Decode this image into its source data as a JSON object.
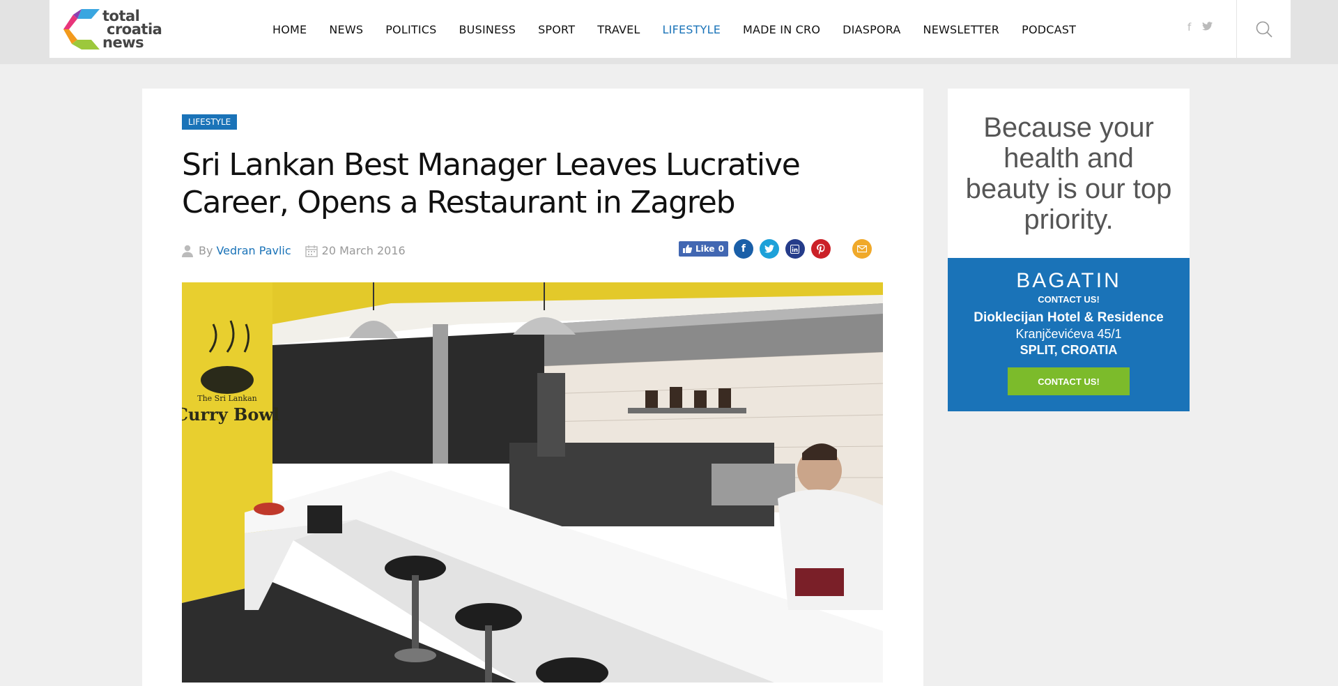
{
  "logo": {
    "line1": "total",
    "line2": "croatia",
    "line3": "news"
  },
  "nav": {
    "items": [
      "HOME",
      "NEWS",
      "POLITICS",
      "BUSINESS",
      "SPORT",
      "TRAVEL",
      "LIFESTYLE",
      "MADE IN CRO",
      "DIASPORA",
      "NEWSLETTER",
      "PODCAST"
    ],
    "active": "LIFESTYLE"
  },
  "header_social": {
    "facebook_glyph": "f",
    "twitter_icon": "twitter-icon"
  },
  "article": {
    "category": "LIFESTYLE",
    "title": "Sri Lankan Best Manager Leaves Lucrative Career, Opens a Restaurant in Zagreb",
    "by_label": "By",
    "author": "Vedran Pavlic",
    "date": "20 March 2016",
    "share": {
      "like_label": "Like",
      "like_count": "0"
    },
    "hero_sign": {
      "small": "The Sri Lankan",
      "big": "Curry Bowl"
    }
  },
  "ad": {
    "headline": "Because your health and beauty is our top priority.",
    "brand": "BAGATIN",
    "contact_small": "CONTACT US!",
    "hotel": "Dioklecijan Hotel & Residence",
    "street": "Kranjčevićeva 45/1",
    "city": "SPLIT, CROATIA",
    "button": "CONTACT US!"
  },
  "colors": {
    "accent": "#1a73b8",
    "ad_button": "#7cbb2b",
    "pinterest": "#cb2027",
    "email": "#f0a92a"
  }
}
